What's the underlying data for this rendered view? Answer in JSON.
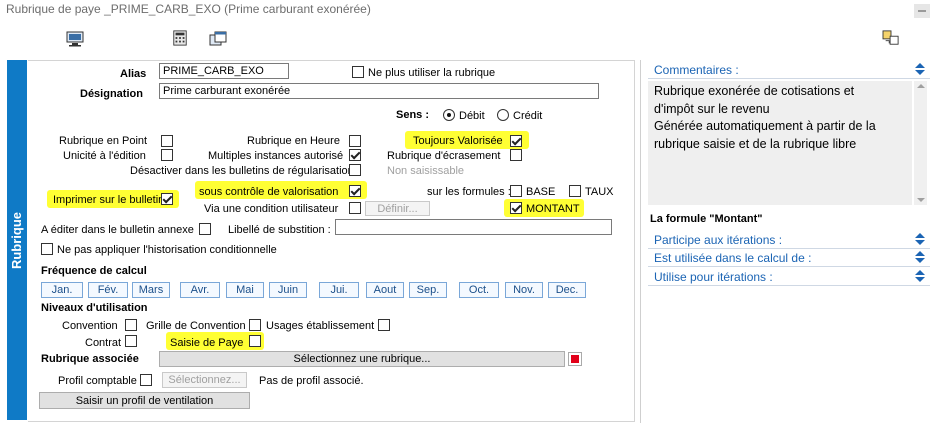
{
  "window": {
    "title": "Rubrique de paye _PRIME_CARB_EXO (Prime carburant exonérée)"
  },
  "toolbar": {
    "icons": [
      "monitor-icon",
      "calculator-icon",
      "window-copy-icon",
      "copy-pages-icon"
    ]
  },
  "left_tab": {
    "label": "Rubrique"
  },
  "form": {
    "alias_label": "Alias",
    "alias_value": "PRIME_CARB_EXO",
    "ne_plus_utiliser_label": "Ne plus utiliser la rubrique",
    "designation_label": "Désignation",
    "designation_value": "Prime carburant exonérée",
    "sens_label": "Sens :",
    "debit_label": "Débit",
    "credit_label": "Crédit",
    "rubrique_en_point": "Rubrique en Point",
    "rubrique_en_heure": "Rubrique en Heure",
    "toujours_valorisee": "Toujours Valorisée",
    "unicite_edition": "Unicité à l'édition",
    "multiples_instances": "Multiples instances autorisé",
    "rubrique_ecrasement": "Rubrique d'écrasement",
    "desactiver_bulletins": "Désactiver dans les bulletins de régularisation",
    "non_saisissable": "Non saisissable",
    "imprimer_bulletin": "Imprimer sur le bulletin",
    "sous_controle": "sous contrôle de valorisation",
    "sur_les_formules": "sur les formules :",
    "base": "BASE",
    "taux": "TAUX",
    "via_condition": "Via une condition utilisateur",
    "definir": "Définir...",
    "montant": "MONTANT",
    "a_editer_annexe": "A éditer dans le bulletin annexe",
    "libelle_substition": "Libellé de substition :",
    "ne_pas_appliquer": "Ne pas appliquer l'historisation conditionnelle",
    "frequence_label": "Fréquence de calcul",
    "months": [
      "Jan.",
      "Fév.",
      "Mars",
      "Avr.",
      "Mai",
      "Juin",
      "Jui.",
      "Aout",
      "Sep.",
      "Oct.",
      "Nov.",
      "Dec."
    ],
    "niveaux_label": "Niveaux d'utilisation",
    "convention": "Convention",
    "grille_convention": "Grille de Convention",
    "usages_etablissement": "Usages établissement",
    "contrat": "Contrat",
    "saisie_de_paye": "Saisie de Paye",
    "rubrique_associee": "Rubrique associée",
    "selectionnez_rubrique": "Sélectionnez une rubrique...",
    "profil_comptable": "Profil comptable",
    "selectionnez": "Sélectionnez...",
    "pas_de_profil": "Pas de profil associé.",
    "saisir_profil": "Saisir un profil de ventilation"
  },
  "right": {
    "commentaires_label": "Commentaires :",
    "comment_lines": [
      "Rubrique exonérée de cotisations et",
      "d'impôt sur le revenu",
      "Générée automatiquement à partir de la",
      "rubrique saisie et de la rubrique libre"
    ],
    "formule_label": "La formule \"Montant\"",
    "participe": "Participe aux itérations :",
    "est_utilisee": "Est utilisée dans le calcul de :",
    "utilise": "Utilise pour itérations :"
  },
  "colors": {
    "accent": "#0f7ac6",
    "highlight": "#ffff34",
    "section_text": "#1b64b4",
    "red_marker": "#e2001a"
  }
}
